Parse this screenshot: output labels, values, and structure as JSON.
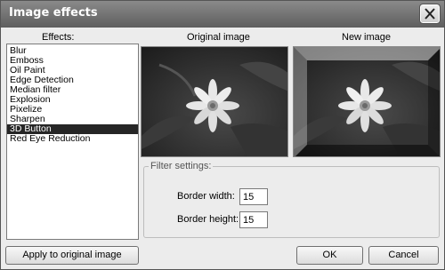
{
  "window": {
    "title": "Image effects"
  },
  "labels": {
    "effects": "Effects:",
    "original": "Original image",
    "new": "New image"
  },
  "effects": {
    "items": [
      "Blur",
      "Emboss",
      "Oil Paint",
      "Edge Detection",
      "Median filter",
      "Explosion",
      "Pixelize",
      "Sharpen",
      "3D Button",
      "Red Eye Reduction"
    ],
    "selected": "3D Button"
  },
  "filter_settings": {
    "legend": "Filter settings:",
    "border_width_label": "Border width:",
    "border_width": "15",
    "border_height_label": "Border height:",
    "border_height": "15"
  },
  "buttons": {
    "apply": "Apply to original image",
    "ok": "OK",
    "cancel": "Cancel"
  },
  "icons": {
    "close": "close-icon"
  }
}
